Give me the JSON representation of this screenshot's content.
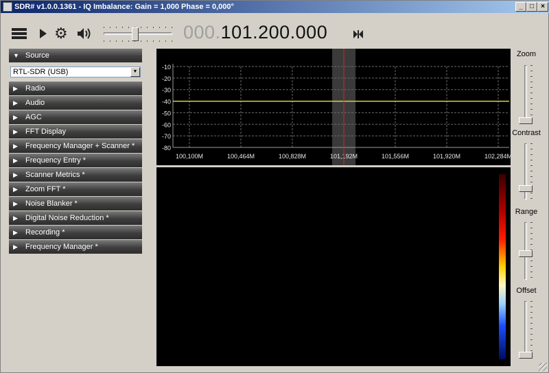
{
  "window": {
    "title": "SDR# v1.0.0.1361 - IQ Imbalance: Gain = 1,000 Phase = 0,000°"
  },
  "toolbar": {
    "frequency_dim": "000.",
    "frequency_main": "101.200.000",
    "volume_level": 0.45
  },
  "left_panel": {
    "source": {
      "label": "Source",
      "selected": "RTL-SDR (USB)"
    },
    "items": [
      "Radio",
      "Audio",
      "AGC",
      "FFT Display",
      "Frequency Manager + Scanner *",
      "Frequency Entry *",
      "Scanner Metrics *",
      "Zoom FFT *",
      "Noise Blanker *",
      "Digital Noise Reduction *",
      "Recording *",
      "Frequency Manager *"
    ]
  },
  "spectrum": {
    "y_ticks": [
      "-10",
      "-20",
      "-30",
      "-40",
      "-50",
      "-60",
      "-70",
      "-80"
    ],
    "x_ticks": [
      "100,100M",
      "100,464M",
      "100,828M",
      "101,192M",
      "101,556M",
      "101,920M",
      "102,284M"
    ],
    "signal_level_db": -40,
    "colors": {
      "grid": "#6b6b6b",
      "trace": "#d8d24a",
      "center": "#e02020"
    }
  },
  "right_panel": {
    "zoom": {
      "label": "Zoom",
      "level": 0.0
    },
    "contrast": {
      "label": "Contrast",
      "level": 0.15
    },
    "range": {
      "label": "Range",
      "level": 0.45
    },
    "offset": {
      "label": "Offset",
      "level": 0.0
    }
  }
}
